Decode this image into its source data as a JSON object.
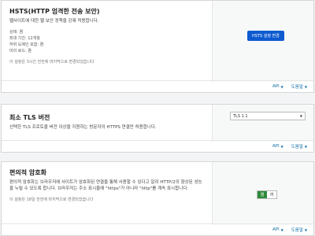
{
  "hsts": {
    "title": "HSTS(HTTP 엄격한 전송 보안)",
    "description": "웹사이트에 대한 웹 보안 정책을 강제 적용합니다.",
    "details": [
      "상태: 켬",
      "최대 기간: 12개월",
      "하위 도메인 포함: 켬",
      "미리 로드: 켬"
    ],
    "modified": "이 설정은 3시간 전전에 마지막으로 변경되었습니다",
    "button_label": "HSTS 설정 변경",
    "api_label": "API",
    "help_label": "도움말"
  },
  "tls": {
    "title": "최소 TLS 버전",
    "description": "선택한 TLS 프로토콜 버전 이상을 지원하는 방문자의 HTTPS 연결만 허용합니다.",
    "selected_version": "TLS 1.1",
    "api_label": "API",
    "help_label": "도움말"
  },
  "oe": {
    "title": "편의적 암호화",
    "description": "편의적 암호화는 브라우저에 사이트가 암호화된 연결을 통해 사용할 수 있다고 알려 HTTP/2의 향상된 성능을 누릴 수 있도록 합니다. 브라우저는 주소 표시줄에 \"https\"가 아니라 \"http\"를 계속 표시합니다.",
    "modified": "이 설정은 18일 전전에 마지막으로 변경되었습니다",
    "toggle_on": "켬",
    "toggle_off": "꺼",
    "api_label": "API",
    "help_label": "도움말"
  },
  "colors": {
    "primary_button": "#0e5bd0",
    "toggle_on": "#2f8a3a",
    "link": "#0e6fa8"
  }
}
